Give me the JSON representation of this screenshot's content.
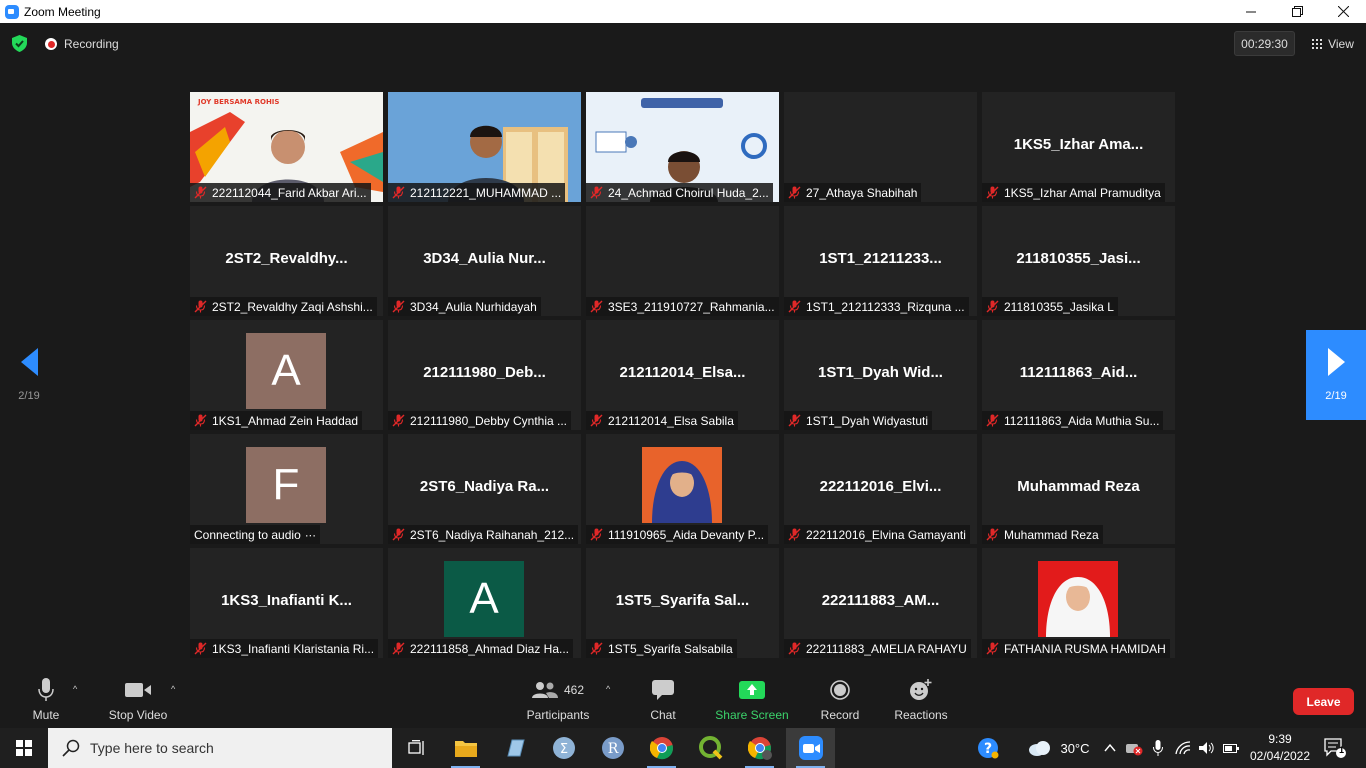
{
  "window": {
    "title": "Zoom Meeting"
  },
  "topbar": {
    "recording_label": "Recording",
    "timer": "00:29:30",
    "view_label": "View"
  },
  "navigation": {
    "prev_page": "2/19",
    "next_page": "2/19"
  },
  "tiles": [
    {
      "name": "222112044_Farid Akbar Ari...",
      "type": "video",
      "muted": true
    },
    {
      "name": "212112221_MUHAMMAD ...",
      "type": "video",
      "muted": true
    },
    {
      "name": "24_Achmad Choirul Huda_2...",
      "type": "video",
      "muted": true
    },
    {
      "name": "27_Athaya Shabihah",
      "type": "blank",
      "muted": true
    },
    {
      "name": "1KS5_Izhar Amal Pramuditya",
      "display": "1KS5_Izhar  Ama...",
      "type": "name",
      "muted": true
    },
    {
      "name": "2ST2_Revaldhy Zaqi Ashshi...",
      "display": "2ST2_Revaldhy...",
      "type": "name",
      "muted": true
    },
    {
      "name": "3D34_Aulia Nurhidayah",
      "display": "3D34_Aulia  Nur...",
      "type": "name",
      "muted": true
    },
    {
      "name": "3SE3_211910727_Rahmania...",
      "type": "blank",
      "muted": true
    },
    {
      "name": "1ST1_212112333_Rizquna ...",
      "display": "1ST1_21211233...",
      "type": "name",
      "muted": true
    },
    {
      "name": "211810355_Jasika L",
      "display": "211810355_Jasi...",
      "type": "name",
      "muted": true
    },
    {
      "name": "1KS1_Ahmad Zein Haddad",
      "avatar": "A",
      "avatar_color": "#8d6e63",
      "type": "avatar",
      "muted": true
    },
    {
      "name": "212111980_Debby Cynthia ...",
      "display": "212111980_Deb...",
      "type": "name",
      "muted": true
    },
    {
      "name": "212112014_Elsa Sabila",
      "display": "212112014_Elsa...",
      "type": "name",
      "muted": true
    },
    {
      "name": "1ST1_Dyah Widyastuti",
      "display": "1ST1_Dyah  Wid...",
      "type": "name",
      "muted": true
    },
    {
      "name": "112111863_Aida Muthia Su...",
      "display": "112111863_Aid...",
      "type": "name",
      "muted": true
    },
    {
      "name": "Connecting to audio",
      "status_suffix": "·∙·",
      "avatar": "F",
      "avatar_color": "#8d6e63",
      "type": "avatar",
      "muted": false
    },
    {
      "name": "2ST6_Nadiya Raihanah_212...",
      "display": "2ST6_Nadiya  Ra...",
      "type": "name",
      "muted": true
    },
    {
      "name": "111910965_Aida Devanty P...",
      "type": "photo",
      "photo_bg": "#e8632b",
      "muted": true
    },
    {
      "name": "222112016_Elvina Gamayanti",
      "display": "222112016_Elvi...",
      "type": "name",
      "muted": true
    },
    {
      "name": "Muhammad Reza",
      "display": "Muhammad Reza",
      "type": "name",
      "muted": true
    },
    {
      "name": "1KS3_Inafianti Klaristania Ri...",
      "display": "1KS3_Inafianti  K...",
      "type": "name",
      "muted": true
    },
    {
      "name": "222111858_Ahmad Diaz Ha...",
      "avatar": "A",
      "avatar_color": "#0b5a46",
      "type": "avatar",
      "muted": true
    },
    {
      "name": "1ST5_Syarifa Salsabila",
      "display": "1ST5_Syarifa  Sal...",
      "type": "name",
      "muted": true
    },
    {
      "name": "222111883_AMELIA RAHAYU",
      "display": "222111883_AM...",
      "type": "name",
      "muted": true
    },
    {
      "name": "FATHANIA RUSMA HAMIDAH",
      "type": "photo",
      "photo_bg": "#e21b1b",
      "muted": true
    }
  ],
  "toolbar": {
    "mute": "Mute",
    "stop_video": "Stop Video",
    "participants": "Participants",
    "participant_count": "462",
    "chat": "Chat",
    "share_screen": "Share Screen",
    "record": "Record",
    "reactions": "Reactions",
    "leave": "Leave"
  },
  "taskbar": {
    "search_placeholder": "Type here to search",
    "weather": "30°C",
    "time": "9:39",
    "date": "02/04/2022",
    "notification_count": "1"
  },
  "colors": {
    "accent": "#2d8cff",
    "leave": "#e02828",
    "share": "#3bd36b",
    "muted": "#e02828"
  }
}
